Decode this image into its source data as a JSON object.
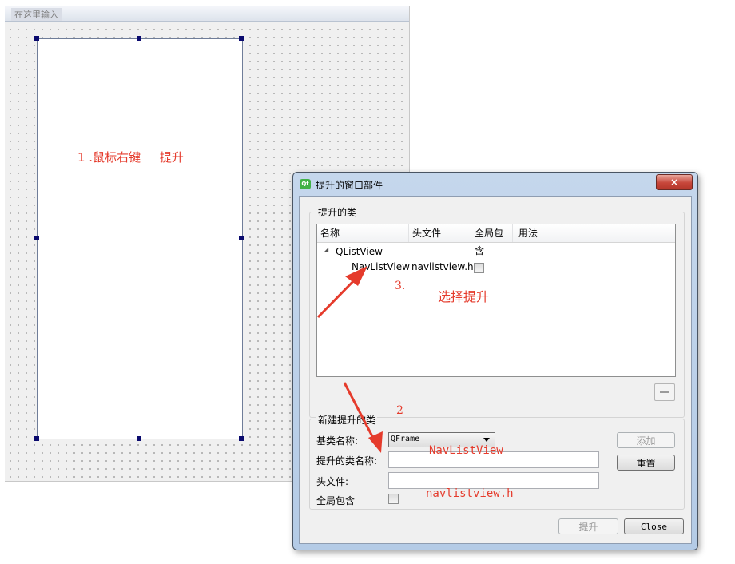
{
  "designer": {
    "menu_hint": "在这里输入",
    "annotation_1": "1 .鼠标右键     提升"
  },
  "dialog": {
    "title": "提升的窗口部件",
    "app_icon": "Qt",
    "close_icon": "×",
    "promoted_group": {
      "title": "提升的类",
      "columns": [
        "名称",
        "头文件",
        "全局包含",
        "用法"
      ],
      "tree": {
        "parent": "QListView",
        "child_name": "NavListView",
        "child_header": "navlistview.h",
        "child_global_include": false
      }
    },
    "new_group": {
      "title": "新建提升的类",
      "base_class_label": "基类名称:",
      "base_class_value": "QFrame",
      "promoted_name_label": "提升的类名称:",
      "promoted_name_value": "",
      "header_label": "头文件:",
      "header_value": "",
      "global_include_label": "全局包含",
      "global_include": false,
      "add_button": "添加",
      "reset_button": "重置"
    },
    "promote_button": "提升",
    "close_button": "Close"
  },
  "annotations": {
    "step3_number": "3.",
    "step3_text": "选择提升",
    "step2_number": "2",
    "class_name_hint": "NavListView",
    "header_hint": "navlistview.h"
  },
  "colors": {
    "annotation": "#e53b2c",
    "dialog_frame": "#b4cbe6",
    "close_button": "#c7463a"
  }
}
